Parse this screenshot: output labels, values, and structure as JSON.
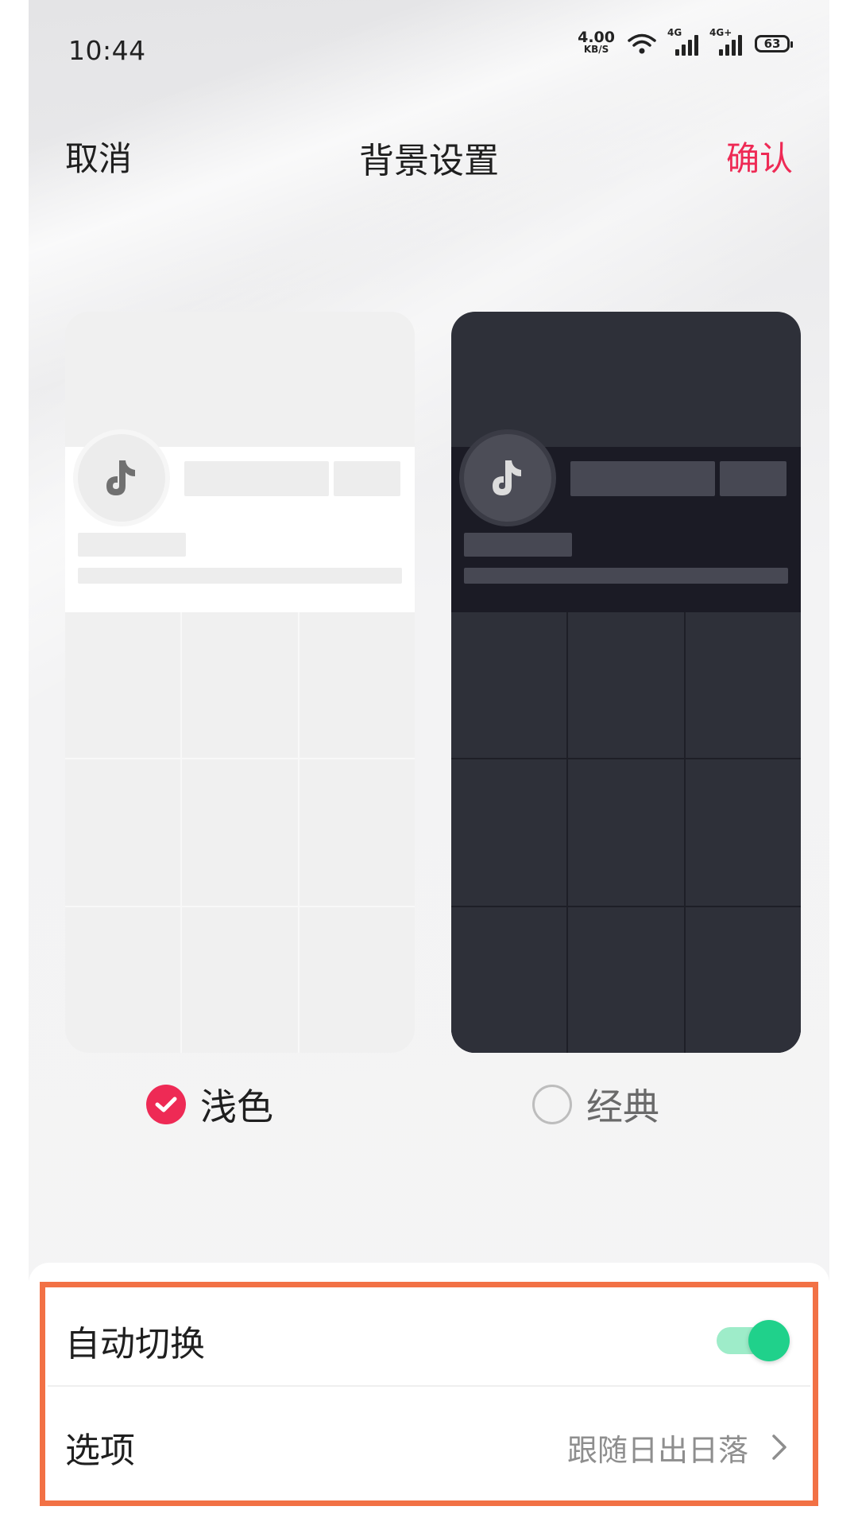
{
  "status_bar": {
    "time": "10:44",
    "net_speed_value": "4.00",
    "net_speed_unit": "KB/S",
    "signal1_label": "4G",
    "signal2_label": "4G+",
    "battery": "63"
  },
  "nav": {
    "cancel_label": "取消",
    "title": "背景设置",
    "confirm_label": "确认"
  },
  "themes": {
    "light_label": "浅色",
    "dark_label": "经典",
    "selected": "light"
  },
  "settings": {
    "auto_switch_label": "自动切换",
    "auto_switch_on": true,
    "option_label": "选项",
    "option_value": "跟随日出日落"
  },
  "colors": {
    "accent": "#ee2a55",
    "toggle_on": "#20d18b",
    "highlight_border": "#f27145"
  }
}
